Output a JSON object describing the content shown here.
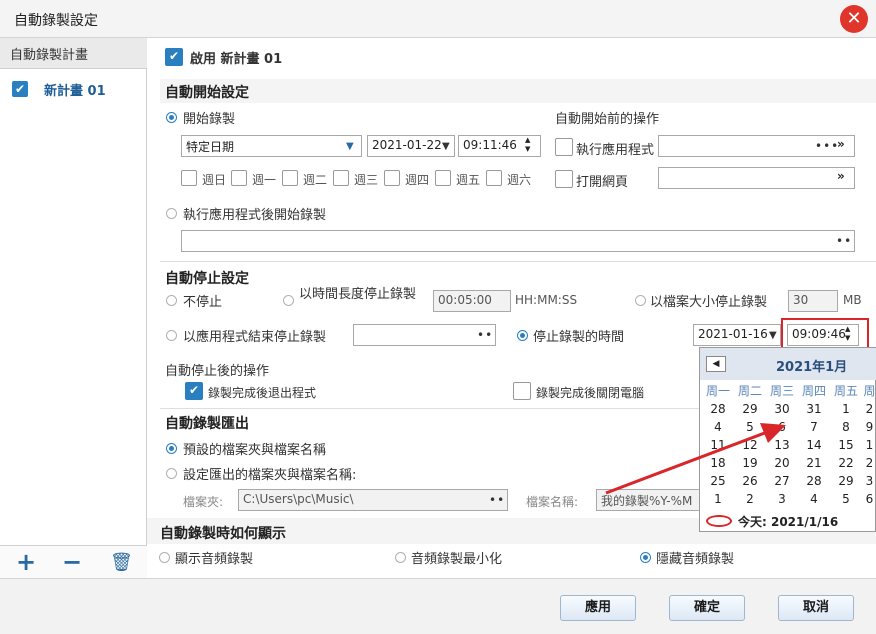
{
  "window": {
    "title": "自動錄製設定",
    "close": "✕"
  },
  "sidebar": {
    "header": "自動錄製計畫",
    "items": [
      {
        "label": "新計畫 01"
      }
    ],
    "add": "+",
    "remove": "−",
    "delete": "🗑"
  },
  "plan": {
    "enable_label": "啟用 新計畫 01"
  },
  "auto_start": {
    "title": "自動開始設定",
    "start_recording": "開始錄製",
    "mode_select": "特定日期",
    "date": "2021-01-22",
    "time": "09:11:46",
    "weekdays": [
      "週日",
      "週一",
      "週二",
      "週三",
      "週四",
      "週五",
      "週六"
    ],
    "after_app": "執行應用程式後開始錄製",
    "pre_actions_title": "自動開始前的操作",
    "run_app": "執行應用程式",
    "open_web": "打開網頁"
  },
  "auto_stop": {
    "title": "自動停止設定",
    "no_stop": "不停止",
    "by_duration": "以時間長度停止錄製",
    "duration": "00:05:00",
    "duration_unit": "HH:MM:SS",
    "by_size": "以檔案大小停止錄製",
    "size": "30",
    "size_unit": "MB",
    "by_app_end": "以應用程式結束停止錄製",
    "by_time": "停止錄製的時間",
    "stop_date": "2021-01-16",
    "stop_time": "09:09:46",
    "post_title": "自動停止後的操作",
    "exit_app": "錄製完成後退出程式",
    "shutdown": "錄製完成後關閉電腦"
  },
  "export": {
    "title": "自動錄製匯出",
    "default": "預設的檔案夾與檔案名稱",
    "custom": "設定匯出的檔案夾與檔案名稱:",
    "folder_label": "檔案夾:",
    "folder": "C:\\Users\\pc\\Music\\",
    "filename_label": "檔案名稱:",
    "filename": "我的錄製%Y-%M"
  },
  "display": {
    "title": "自動錄製時如何顯示",
    "show": "顯示音頻錄製",
    "minimize": "音頻錄製最小化",
    "hide": "隱藏音頻錄製"
  },
  "buttons": {
    "apply": "應用",
    "ok": "確定",
    "cancel": "取消"
  },
  "calendar": {
    "month": "2021年1月",
    "prev": "◀",
    "weekdays": [
      "周一",
      "周二",
      "周三",
      "周四",
      "周五",
      "周"
    ],
    "rows": [
      [
        "28",
        "29",
        "30",
        "31",
        "1",
        "2"
      ],
      [
        "4",
        "5",
        "6",
        "7",
        "8",
        "9"
      ],
      [
        "11",
        "12",
        "13",
        "14",
        "15",
        "1"
      ],
      [
        "18",
        "19",
        "20",
        "21",
        "22",
        "2"
      ],
      [
        "25",
        "26",
        "27",
        "28",
        "29",
        "3"
      ],
      [
        "1",
        "2",
        "3",
        "4",
        "5",
        "6"
      ]
    ],
    "today": "今天: 2021/1/16"
  },
  "colors": {
    "accent": "#2a7fc1",
    "highlight": "#d9262b",
    "arrow": "#d8262b"
  }
}
